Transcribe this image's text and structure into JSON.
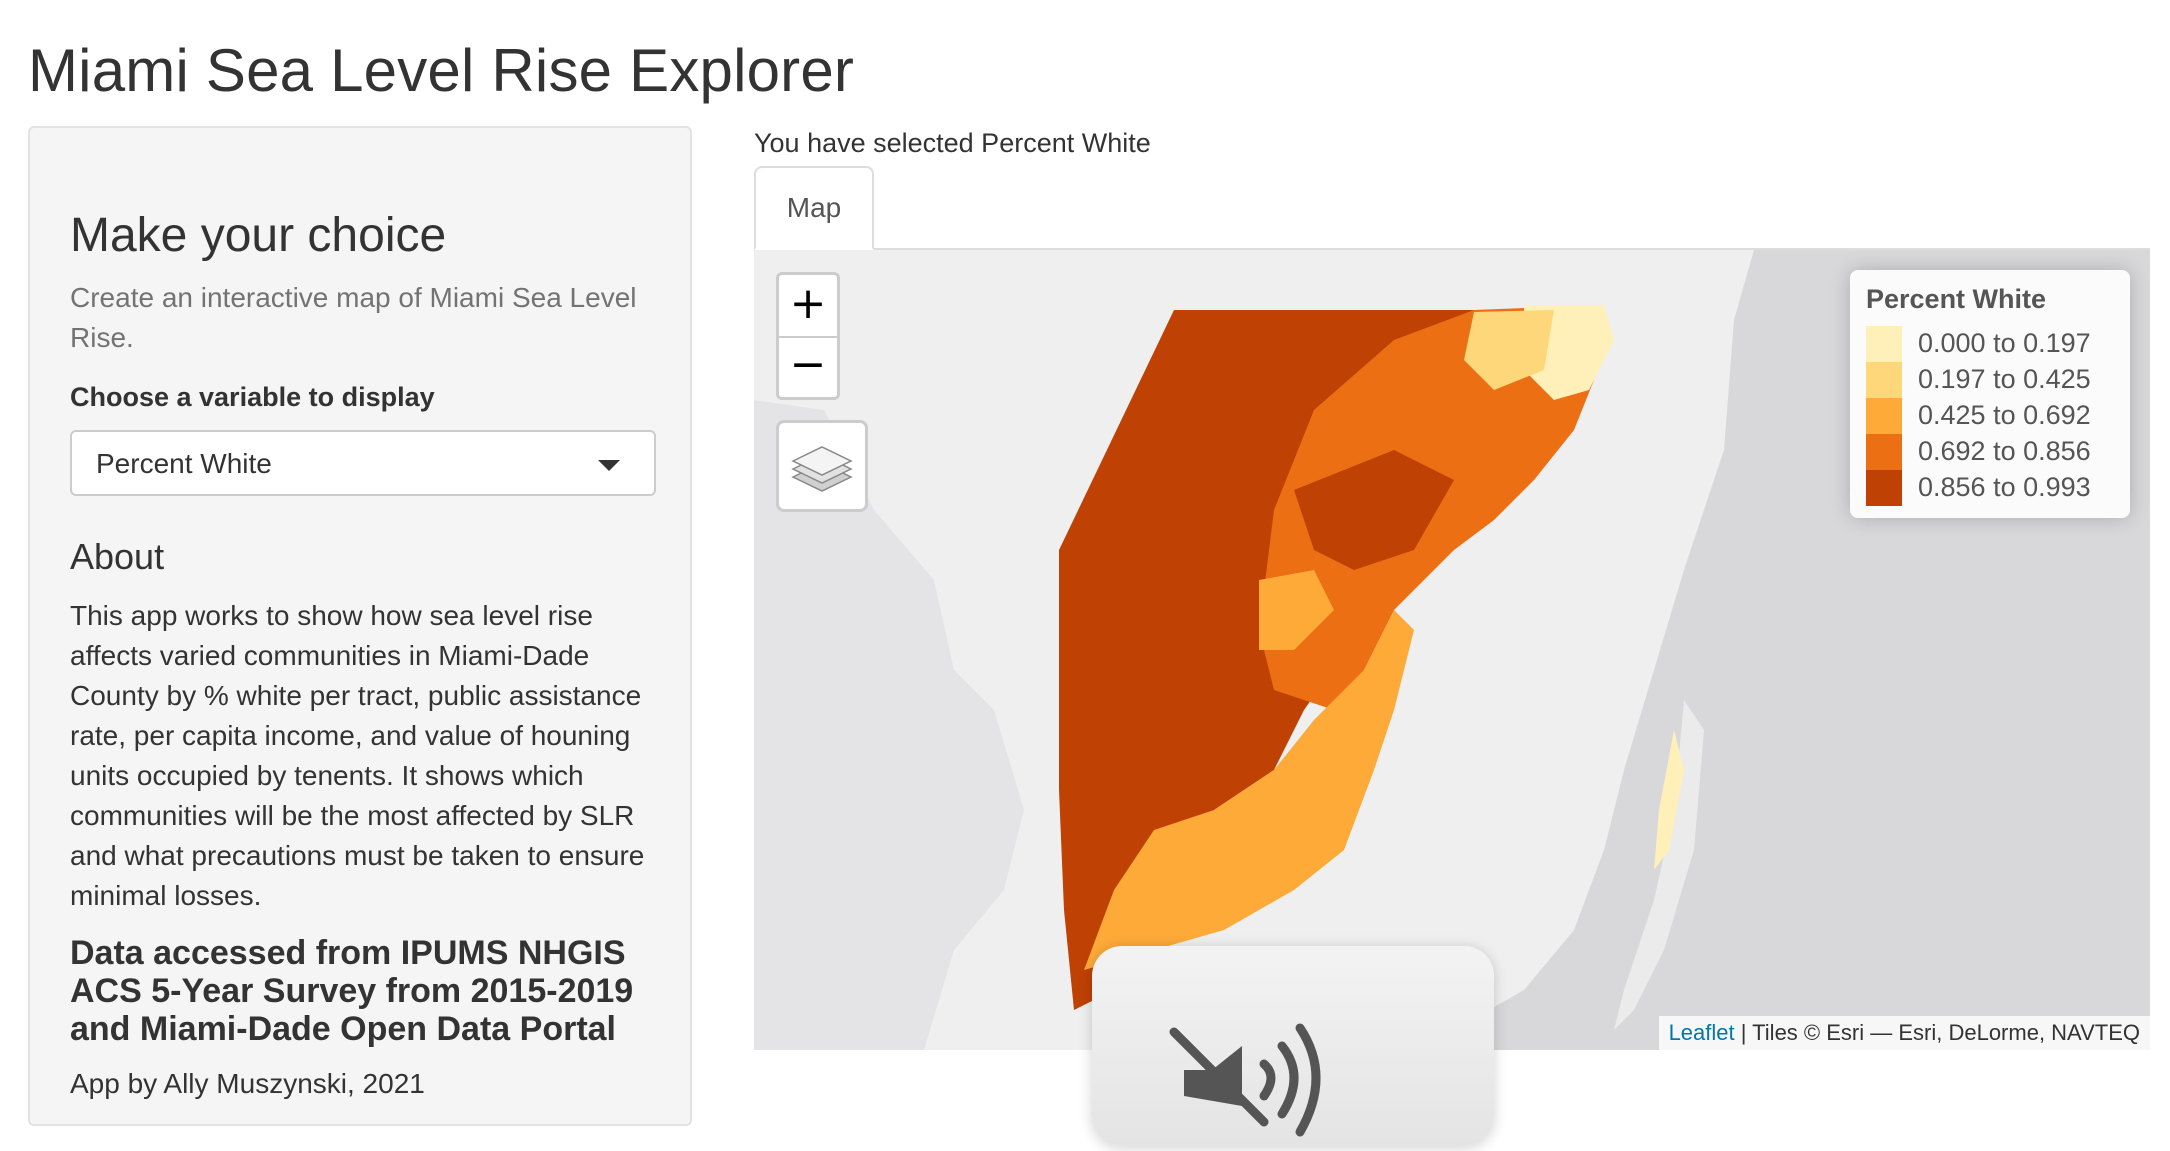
{
  "header": {
    "title": "Miami Sea Level Rise Explorer"
  },
  "sidebar": {
    "heading": "Make your choice",
    "help_text": "Create an interactive map of Miami Sea Level Rise.",
    "select_label": "Choose a variable to display",
    "select_value": "Percent White",
    "about_heading": "About",
    "about_text": "This app works to show how sea level rise affects varied communities in Miami-Dade County by % white per tract, public assistance rate, per capita income, and value of houning units occupied by tenents. It shows which communities will be the most affected by SLR and what precautions must be taken to ensure minimal losses.",
    "data_heading": "Data accessed from IPUMS NHGIS ACS 5-Year Survey from 2015-2019 and Miami-Dade Open Data Portal",
    "credit": "App by Ally Muszynski, 2021"
  },
  "main": {
    "selected_text": "You have selected Percent White",
    "tabs": [
      {
        "label": "Map"
      }
    ]
  },
  "map": {
    "zoom_in": "+",
    "zoom_out": "−",
    "legend": {
      "title": "Percent White",
      "items": [
        {
          "label": "0.000 to 0.197",
          "color": "#ffefb8"
        },
        {
          "label": "0.197 to 0.425",
          "color": "#fed77a"
        },
        {
          "label": "0.425 to 0.692",
          "color": "#fdaa38"
        },
        {
          "label": "0.692 to 0.856",
          "color": "#ec6f14"
        },
        {
          "label": "0.856 to 0.993",
          "color": "#bf4104"
        }
      ]
    },
    "attribution": {
      "link": "Leaflet",
      "text": " | Tiles © Esri — Esri, DeLorme, NAVTEQ"
    }
  },
  "colors": {
    "water": "#d8d8da",
    "land": "#efefef",
    "accent": "#bf4104"
  },
  "icons": {
    "layers": "layers-icon",
    "mute": "speaker-muted-icon"
  }
}
